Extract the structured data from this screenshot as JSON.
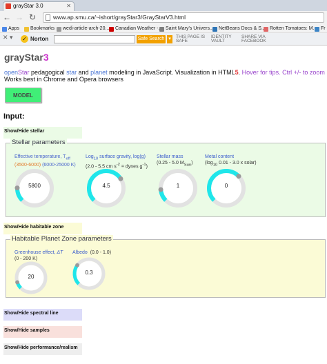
{
  "browser": {
    "tab_title": "grayStar 3.0",
    "url": "www.ap.smu.ca/~ishort/grayStar3/GrayStarV3.html",
    "bookmarks": [
      {
        "label": "Apps",
        "color": "#4a86e8"
      },
      {
        "label": "Bookmarks",
        "color": "#f1c232"
      },
      {
        "label": "wedi-article-arch-20...",
        "color": "#999999"
      },
      {
        "label": "Canadian Weather -...",
        "color": "#cc0000"
      },
      {
        "label": "Saint Mary's Univers...",
        "color": "#7f7f7f"
      },
      {
        "label": "NetBeans Docs & S...",
        "color": "#2e75b6"
      },
      {
        "label": "Rotten Tomatoes: M...",
        "color": "#e06666"
      },
      {
        "label": "Fr",
        "color": "#3d85c6"
      }
    ],
    "norton": {
      "brand": "Norton",
      "safe_search_label": "Safe Search",
      "safe_page": [
        "THIS PAGE IS",
        "SAFE"
      ],
      "identity_vault": [
        "IDENTITY",
        "VAULT"
      ],
      "share_facebook": [
        "SHARE VIA",
        "FACEBOOK"
      ]
    }
  },
  "page": {
    "title_main": "grayStar",
    "title_suffix": "3",
    "intro_open": "open",
    "intro_star_word": "Star",
    "intro_text1": " pedagogical ",
    "intro_star": "star",
    "intro_and": " and ",
    "intro_planet": "planet",
    "intro_text2": " modeling in JavaScript. Visualization in HTML",
    "intro_html_num": "5",
    "intro_text3": ". ",
    "intro_tips": "Hover for tips. Ctrl +/- to zoom",
    "intro_line2": "Works best in Chrome and Opera browsers",
    "model_button": "MODEL",
    "input_heading": "Input:",
    "toggles": {
      "stellar": "Show/Hide stellar",
      "habitable": "Show/Hide habitable zone",
      "spectral": "Show/Hide spectral line",
      "samples": "Show/Hide samples",
      "performance": "Show/Hide performance/realism"
    },
    "toggle_colors": {
      "stellar": "#ebfbe6",
      "habitable": "#fbfbd6",
      "spectral": "#dcdcf9",
      "samples": "#f9e0dc",
      "performance": "#eeeeee"
    },
    "stellar_panel": {
      "title": "Stellar parameters",
      "background": "#ebfbe6",
      "gauges": [
        {
          "cap1": "Effective temperature, T",
          "cap1_sub": "eff",
          "cap2a": "(3500-6000)",
          "cap2b": " (6000-25000 K)",
          "value": "5800",
          "fill": 0.17
        },
        {
          "cap1": "Log",
          "cap1_sub": "10",
          "cap1_rest": " surface gravity, log(g)",
          "cap2": "(2.0 - 5.5 cm s",
          "cap2_sup": "-2",
          "cap2_rest": " = dynes g",
          "cap2_sup2": "-1",
          "cap2_end": ")",
          "value": "4.5",
          "fill": 0.71
        },
        {
          "cap1": "Stellar mass",
          "cap2": "(0.25 - 5.0 M",
          "cap2_sub": "Sun",
          "cap2_end": ")",
          "value": "1",
          "fill": 0.15
        },
        {
          "cap1": "Metal content",
          "cap2": "(log",
          "cap2_sub": "10",
          "cap2_end": " 0.01 - 3.0 x solar)",
          "value": "0",
          "fill": 0.67
        }
      ]
    },
    "habitable_panel": {
      "title": "Habitable Planet Zone parameters",
      "background": "#fbfbd6",
      "gauges": [
        {
          "cap1": "Greenhouse effect, ",
          "cap1_sym": "ΔT",
          "cap2": "(0 - 200 K)",
          "value": "20",
          "fill": 0.1
        },
        {
          "cap1": "Albedo",
          "cap2": "(0.0 - 1.0)",
          "value": "0.3",
          "fill": 0.3
        }
      ]
    }
  }
}
